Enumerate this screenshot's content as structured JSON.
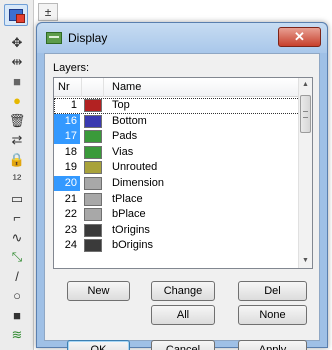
{
  "toolbar": {
    "tab_glyph": "±",
    "tools": [
      {
        "icon": "move-icon",
        "glyph": "✥"
      },
      {
        "icon": "mirror-icon",
        "glyph": "⇹"
      },
      {
        "icon": "rectangle-icon",
        "glyph": "■"
      },
      {
        "icon": "color-dot-icon",
        "glyph": "●"
      },
      {
        "icon": "delete-icon",
        "glyph": "🗑"
      },
      {
        "icon": "swap-icon",
        "glyph": "⇄"
      },
      {
        "icon": "lock-icon",
        "glyph": "🔒"
      },
      {
        "icon": "smash-icon",
        "glyph": "¹²"
      },
      {
        "icon": "package-icon",
        "glyph": "▭"
      },
      {
        "icon": "wire-icon",
        "glyph": "⌐"
      },
      {
        "icon": "meander-icon",
        "glyph": "∿"
      },
      {
        "icon": "route-icon",
        "glyph": "⤡"
      },
      {
        "icon": "line-icon",
        "glyph": "/"
      },
      {
        "icon": "circle-icon",
        "glyph": "○"
      },
      {
        "icon": "fill-rect-icon",
        "glyph": "■"
      },
      {
        "icon": "layers-icon",
        "glyph": "≋"
      }
    ]
  },
  "dialog": {
    "title": "Display",
    "close_glyph": "✕",
    "layers_label": "Layers:",
    "columns": {
      "nr": "Nr",
      "name": "Name"
    },
    "layers": [
      {
        "nr": "1",
        "name": "Top",
        "color": "#b22222",
        "selected": false,
        "current": true
      },
      {
        "nr": "16",
        "name": "Bottom",
        "color": "#3a3ab0",
        "selected": true,
        "current": false
      },
      {
        "nr": "17",
        "name": "Pads",
        "color": "#3a9a3a",
        "selected": true,
        "current": false
      },
      {
        "nr": "18",
        "name": "Vias",
        "color": "#3a9a3a",
        "selected": false,
        "current": false
      },
      {
        "nr": "19",
        "name": "Unrouted",
        "color": "#a8a23a",
        "selected": false,
        "current": false
      },
      {
        "nr": "20",
        "name": "Dimension",
        "color": "#a8a8a8",
        "selected": true,
        "current": false
      },
      {
        "nr": "21",
        "name": "tPlace",
        "color": "#a8a8a8",
        "selected": false,
        "current": false
      },
      {
        "nr": "22",
        "name": "bPlace",
        "color": "#a8a8a8",
        "selected": false,
        "current": false
      },
      {
        "nr": "23",
        "name": "tOrigins",
        "color": "#3a3a3a",
        "selected": false,
        "current": false
      },
      {
        "nr": "24",
        "name": "bOrigins",
        "color": "#3a3a3a",
        "selected": false,
        "current": false
      }
    ],
    "buttons": {
      "new": "New",
      "change": "Change",
      "del": "Del",
      "all": "All",
      "none": "None",
      "ok": "OK",
      "cancel": "Cancel",
      "apply": "Apply"
    },
    "list_scroll_position": 0.05
  },
  "colors": {
    "selection": "#3399ff",
    "titlebar": "#a9c7ea",
    "close_button": "#c7402c"
  }
}
